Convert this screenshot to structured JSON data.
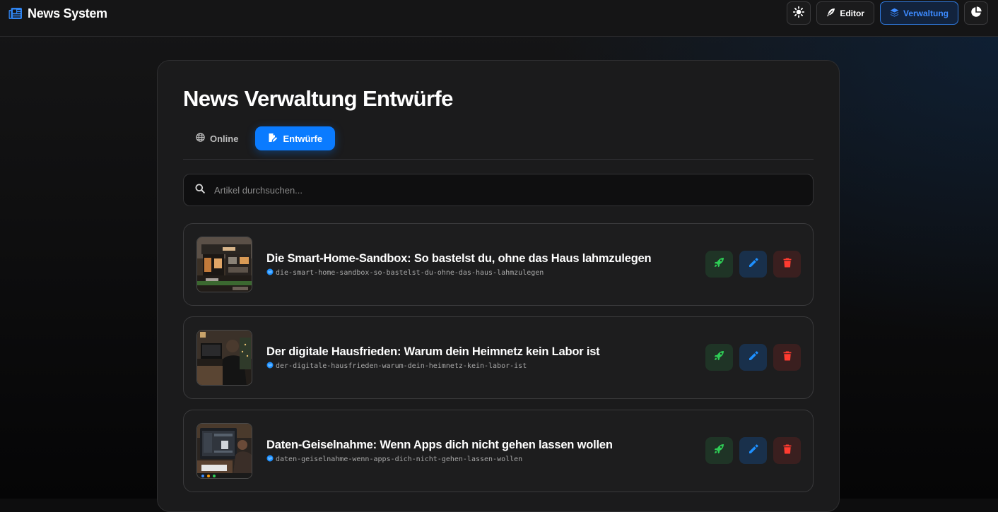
{
  "app": {
    "title": "News System",
    "icon": "newspaper-icon"
  },
  "nav": {
    "theme_icon": "sun-icon",
    "editor_label": "Editor",
    "editor_icon": "feather-icon",
    "verwaltung_label": "Verwaltung",
    "verwaltung_icon": "layers-icon",
    "stats_icon": "pie-chart-icon",
    "active": "Verwaltung"
  },
  "page": {
    "title": "News Verwaltung Entwürfe"
  },
  "tabs": [
    {
      "label": "Online",
      "icon": "globe-icon",
      "active": false
    },
    {
      "label": "Entwürfe",
      "icon": "file-pen-icon",
      "active": true
    }
  ],
  "search": {
    "placeholder": "Artikel durchsuchen...",
    "value": ""
  },
  "articles": [
    {
      "title": "Die Smart-Home-Sandbox: So bastelst du, ohne das Haus lahmzulegen",
      "slug": "die-smart-home-sandbox-so-bastelst-du-ohne-das-haus-lahmzulegen",
      "thumbnail": "modern-house-at-dusk"
    },
    {
      "title": "Der digitale Hausfrieden: Warum dein Heimnetz kein Labor ist",
      "slug": "der-digitale-hausfrieden-warum-dein-heimnetz-kein-labor-ist",
      "thumbnail": "man-at-computer-desk"
    },
    {
      "title": "Daten-Geiselnahme: Wenn Apps dich nicht gehen lassen wollen",
      "slug": "daten-geiselnahme-wenn-apps-dich-nicht-gehen-lassen-wollen",
      "thumbnail": "person-at-laptop-with-apps"
    }
  ],
  "colors": {
    "accent": "#0a7bff",
    "publish": "#2ecc55",
    "edit": "#1e90ff",
    "delete": "#ff3b30",
    "slug_icon": "#1e90ff"
  }
}
